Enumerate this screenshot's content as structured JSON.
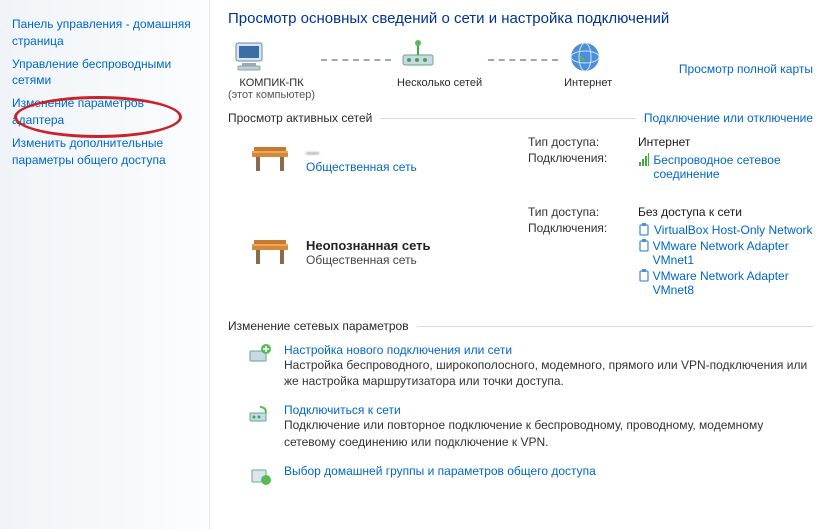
{
  "sidebar": {
    "items": [
      "Панель управления - домашняя страница",
      "Управление беспроводными сетями",
      "Изменение параметров адаптера",
      "Изменить дополнительные параметры общего доступа"
    ]
  },
  "header": {
    "title": "Просмотр основных сведений о сети и настройка подключений"
  },
  "map": {
    "full_map": "Просмотр полной карты",
    "node1": {
      "name": "КОМПИК-ПК",
      "sub": "(этот компьютер)"
    },
    "node2": {
      "name": "Несколько сетей"
    },
    "node3": {
      "name": "Интернет"
    }
  },
  "active": {
    "title": "Просмотр активных сетей",
    "toggle": "Подключение или отключение",
    "labels": {
      "access": "Тип доступа:",
      "conn": "Подключения:"
    },
    "net1": {
      "name": "—",
      "type": "Общественная сеть",
      "access": "Интернет",
      "conn": "Беспроводное сетевое соединение"
    },
    "net2": {
      "name": "Неопознанная сеть",
      "type": "Общественная сеть",
      "access": "Без доступа к сети",
      "conns": [
        "VirtualBox Host-Only Network",
        "VMware Network Adapter VMnet1",
        "VMware Network Adapter VMnet8"
      ]
    }
  },
  "change": {
    "title": "Изменение сетевых параметров",
    "tasks": [
      {
        "title": "Настройка нового подключения или сети",
        "desc": "Настройка беспроводного, широкополосного, модемного, прямого или VPN-подключения или же настройка маршрутизатора или точки доступа."
      },
      {
        "title": "Подключиться к сети",
        "desc": "Подключение или повторное подключение к беспроводному, проводному, модемному сетевому соединению или подключение к VPN."
      },
      {
        "title": "Выбор домашней группы и параметров общего доступа",
        "desc": ""
      }
    ]
  }
}
